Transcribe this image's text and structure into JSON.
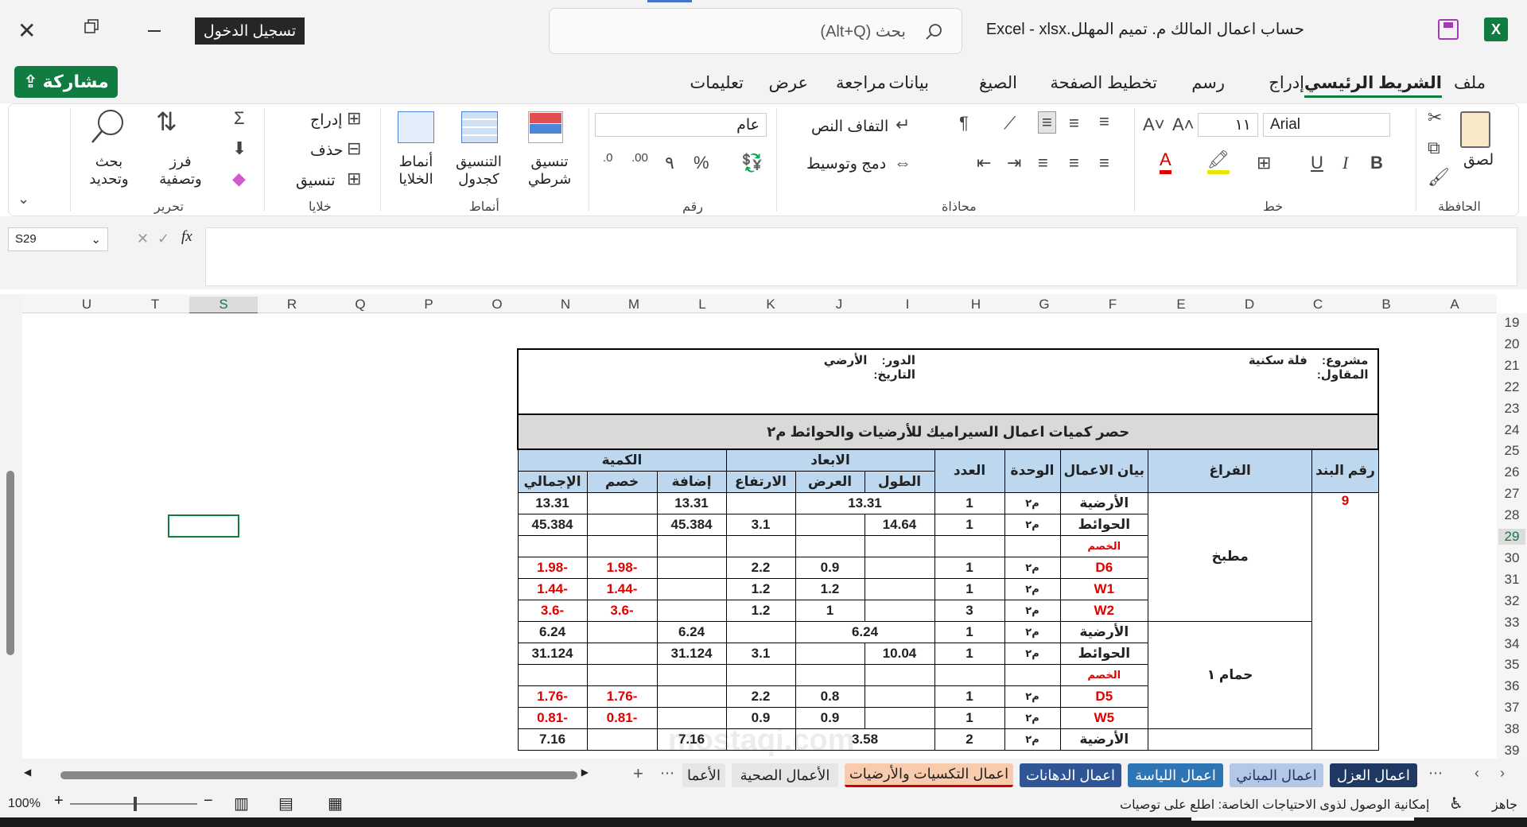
{
  "title_bar": {
    "login_label": "تسجيل الدخول",
    "search_placeholder": "بحث (Alt+Q)",
    "doc_title": "Excel  -  xlsx.حساب اعمال المالك م. تميم المهلل"
  },
  "menu": {
    "share_label": "مشاركة",
    "items": [
      "ملف",
      "الشريط الرئيسي",
      "إدراج",
      "رسم",
      "تخطيط الصفحة",
      "الصيغ",
      "بيانات",
      "مراجعة",
      "عرض",
      "تعليمات"
    ]
  },
  "ribbon": {
    "clipboard": {
      "paste": "لصق",
      "group": "الحافظة"
    },
    "font": {
      "name": "Arial",
      "size": "١١",
      "group": "خط"
    },
    "alignment": {
      "wrap": "التفاف النص",
      "merge": "دمج وتوسيط",
      "group": "محاذاة"
    },
    "number": {
      "format": "عام",
      "group": "رقم"
    },
    "styles": {
      "conditional": "تنسيق شرطي",
      "table": "التنسيق كجدول",
      "cell": "أنماط الخلايا",
      "group": "أنماط"
    },
    "cells": {
      "insert": "إدراج",
      "delete": "حذف",
      "format": "تنسيق",
      "group": "خلايا"
    },
    "editing": {
      "sort": "فرز وتصفية",
      "find": "بحث وتحديد",
      "group": "تحرير"
    }
  },
  "formula_bar": {
    "name_box": "S29",
    "fx": "fx"
  },
  "columns": [
    "A",
    "B",
    "C",
    "D",
    "E",
    "F",
    "G",
    "H",
    "I",
    "J",
    "K",
    "L",
    "M",
    "N",
    "O",
    "P",
    "Q",
    "R",
    "S",
    "T",
    "U"
  ],
  "rows": [
    "19",
    "20",
    "21",
    "22",
    "23",
    "24",
    "25",
    "26",
    "27",
    "28",
    "29",
    "30",
    "31",
    "32",
    "33",
    "34",
    "35",
    "36",
    "37",
    "38",
    "39"
  ],
  "table": {
    "project_label": "مشروع:",
    "project_value": "فلة سكنية",
    "contractor_label": "المقاول:",
    "floor_label": "الدور:",
    "floor_value": "الأرضي",
    "date_label": "التاريخ:",
    "title": "حصر كميات اعمال السيراميك  للأرضيات والحوائط م٢",
    "headers": {
      "item_no": "رقم البند",
      "space": "الفراغ",
      "desc": "بيان الاعمال",
      "unit": "الوحدة",
      "count": "العدد",
      "dims": "الابعاد",
      "length": "الطول",
      "width": "العرض",
      "height": "الارتفاع",
      "qty": "الكمية",
      "add": "إضافة",
      "deduct": "خصم",
      "total": "الإجمالي"
    },
    "item_no": "9",
    "spaces": [
      "مطبخ",
      "حمام ١"
    ],
    "rows": [
      {
        "desc": "الأرضية",
        "unit": "م٢",
        "count": "1",
        "lw": "13.31",
        "h": "",
        "add": "13.31",
        "ded": "",
        "tot": "13.31"
      },
      {
        "desc": "الحوائط",
        "unit": "م٢",
        "count": "1",
        "l": "14.64",
        "w": "",
        "h": "3.1",
        "add": "45.384",
        "ded": "",
        "tot": "45.384"
      },
      {
        "desc": "الخصم",
        "unit": "",
        "count": "",
        "l": "",
        "w": "",
        "h": "",
        "add": "",
        "ded": "",
        "tot": ""
      },
      {
        "desc": "D6",
        "unit": "م٢",
        "count": "1",
        "l": "",
        "w": "0.9",
        "h": "2.2",
        "add": "",
        "ded": "-1.98",
        "tot": "-1.98"
      },
      {
        "desc": "W1",
        "unit": "م٢",
        "count": "1",
        "l": "",
        "w": "1.2",
        "h": "1.2",
        "add": "",
        "ded": "-1.44",
        "tot": "-1.44"
      },
      {
        "desc": "W2",
        "unit": "م٢",
        "count": "3",
        "l": "",
        "w": "1",
        "h": "1.2",
        "add": "",
        "ded": "-3.6",
        "tot": "-3.6"
      },
      {
        "desc": "الأرضية",
        "unit": "م٢",
        "count": "1",
        "lw": "6.24",
        "h": "",
        "add": "6.24",
        "ded": "",
        "tot": "6.24"
      },
      {
        "desc": "الحوائط",
        "unit": "م٢",
        "count": "1",
        "l": "10.04",
        "w": "",
        "h": "3.1",
        "add": "31.124",
        "ded": "",
        "tot": "31.124"
      },
      {
        "desc": "الخصم",
        "unit": "",
        "count": "",
        "l": "",
        "w": "",
        "h": "",
        "add": "",
        "ded": "",
        "tot": ""
      },
      {
        "desc": "D5",
        "unit": "م٢",
        "count": "1",
        "l": "",
        "w": "0.8",
        "h": "2.2",
        "add": "",
        "ded": "-1.76",
        "tot": "-1.76"
      },
      {
        "desc": "W5",
        "unit": "م٢",
        "count": "1",
        "l": "",
        "w": "0.9",
        "h": "0.9",
        "add": "",
        "ded": "-0.81",
        "tot": "-0.81"
      },
      {
        "desc": "الأرضية",
        "unit": "م٢",
        "count": "2",
        "lw": "3.58",
        "h": "",
        "add": "7.16",
        "ded": "",
        "tot": "7.16"
      }
    ]
  },
  "tabs": [
    "اعمال العزل",
    "اعمال المباني",
    "اعمال اللياسة",
    "اعمال الدهانات",
    "اعمال التكسيات والأرضيات",
    "الأعمال الصحية",
    "الأعما"
  ],
  "status": {
    "ready": "جاهز",
    "accessibility": "إمكانية الوصول لذوى الاحتياجات الخاصة: اطلع على توصيات",
    "zoom": "100%"
  },
  "watermark": "mostaqi.com",
  "colors": {
    "excel_green": "#107c41",
    "header_blue": "#bdd7ee",
    "red": "#e00000",
    "tab_blue": "#1f4e9c"
  }
}
